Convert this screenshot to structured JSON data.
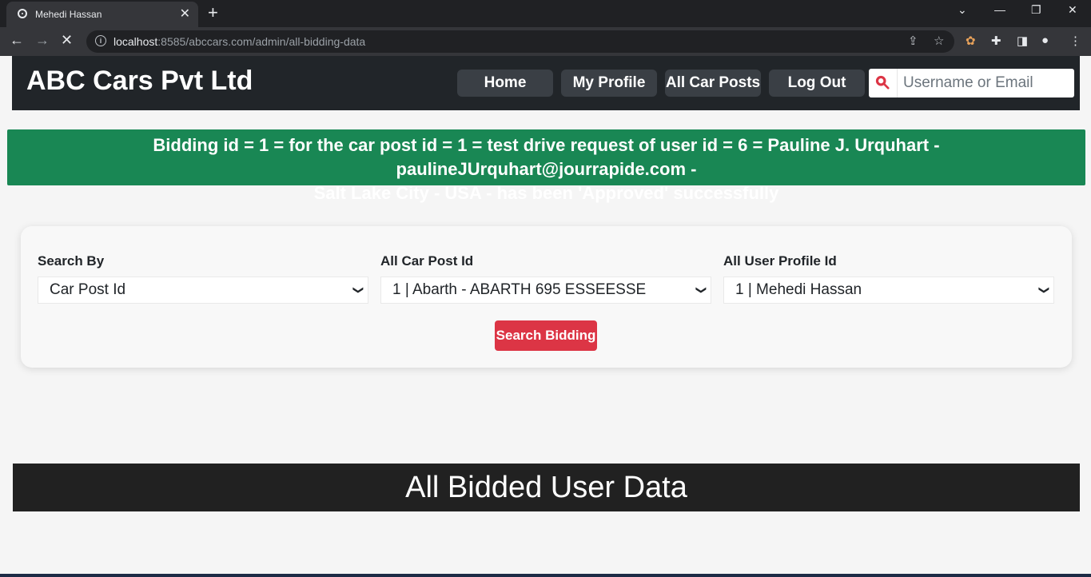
{
  "browser": {
    "tab_title": "Mehedi Hassan",
    "url_host": "localhost",
    "url_rest": ":8585/abccars.com/admin/all-bidding-data"
  },
  "header": {
    "brand": "ABC Cars Pvt Ltd",
    "nav": [
      "Home",
      "My Profile",
      "All Car Posts",
      "Log Out"
    ],
    "search_placeholder": "Username or Email"
  },
  "alert": {
    "line1": "Bidding id = 1 = for the car post id = 1 = test drive request of user id = 6 = Pauline J. Urquhart - paulineJUrquhart@jourrapide.com -",
    "line2": "Salt Lake City - USA - has been 'Approved' successfully",
    "color": "#198754"
  },
  "search_form": {
    "search_by_label": "Search By",
    "search_by_value": "Car Post Id",
    "car_post_label": "All Car Post Id",
    "car_post_value": "1 | Abarth - ABARTH 695 ESSEESSE",
    "user_profile_label": "All User Profile Id",
    "user_profile_value": "1 | Mehedi Hassan",
    "button": "Search Bidding",
    "button_color": "#dc3545"
  },
  "section": {
    "title": "All Bidded User Data"
  }
}
